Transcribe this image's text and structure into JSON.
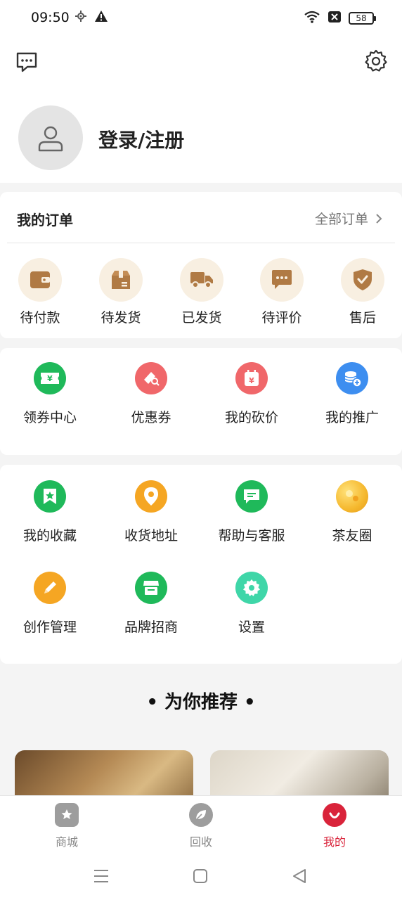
{
  "status_bar": {
    "time": "09:50",
    "battery": "58",
    "icons": [
      "location-icon",
      "warning-icon",
      "wifi-icon",
      "no-sim-icon",
      "battery-icon"
    ]
  },
  "header": {
    "message_icon": "chat-icon",
    "settings_icon": "gear-icon",
    "login_text": "登录/注册"
  },
  "orders": {
    "title": "我的订单",
    "all_link": "全部订单",
    "items": [
      {
        "label": "待付款",
        "icon": "wallet-icon"
      },
      {
        "label": "待发货",
        "icon": "box-icon"
      },
      {
        "label": "已发货",
        "icon": "truck-icon"
      },
      {
        "label": "待评价",
        "icon": "comment-icon"
      },
      {
        "label": "售后",
        "icon": "shield-icon"
      }
    ],
    "icon_color": "#b07a44",
    "icon_bg": "#f8efe1"
  },
  "tools": [
    {
      "label": "领券中心",
      "icon": "ticket-icon",
      "color": "#1fb95a"
    },
    {
      "label": "优惠券",
      "icon": "coupon-icon",
      "color": "#f0676a"
    },
    {
      "label": "我的砍价",
      "icon": "calendar-icon",
      "color": "#f0676a"
    },
    {
      "label": "我的推广",
      "icon": "coins-icon",
      "color": "#3d8ef0"
    }
  ],
  "services": [
    {
      "label": "我的收藏",
      "icon": "bookmark-star-icon",
      "color": "#1fb95a"
    },
    {
      "label": "收货地址",
      "icon": "location-pin-icon",
      "color": "#f5a623"
    },
    {
      "label": "帮助与客服",
      "icon": "chat-bubble-icon",
      "color": "#1fb95a"
    },
    {
      "label": "茶友圈",
      "icon": "circle-icon",
      "color": "#f5b82e"
    },
    {
      "label": "创作管理",
      "icon": "pencil-icon",
      "color": "#f5a623"
    },
    {
      "label": "品牌招商",
      "icon": "store-icon",
      "color": "#1fb95a"
    },
    {
      "label": "设置",
      "icon": "gear-icon",
      "color": "#3fd6a8"
    }
  ],
  "recommend": {
    "title": "• 为你推荐 •"
  },
  "bottom_nav": {
    "items": [
      {
        "label": "商城",
        "icon": "mall-icon",
        "active": false
      },
      {
        "label": "回收",
        "icon": "leaf-icon",
        "active": false
      },
      {
        "label": "我的",
        "icon": "smile-icon",
        "active": true
      }
    ],
    "active_color": "#d9233a"
  }
}
